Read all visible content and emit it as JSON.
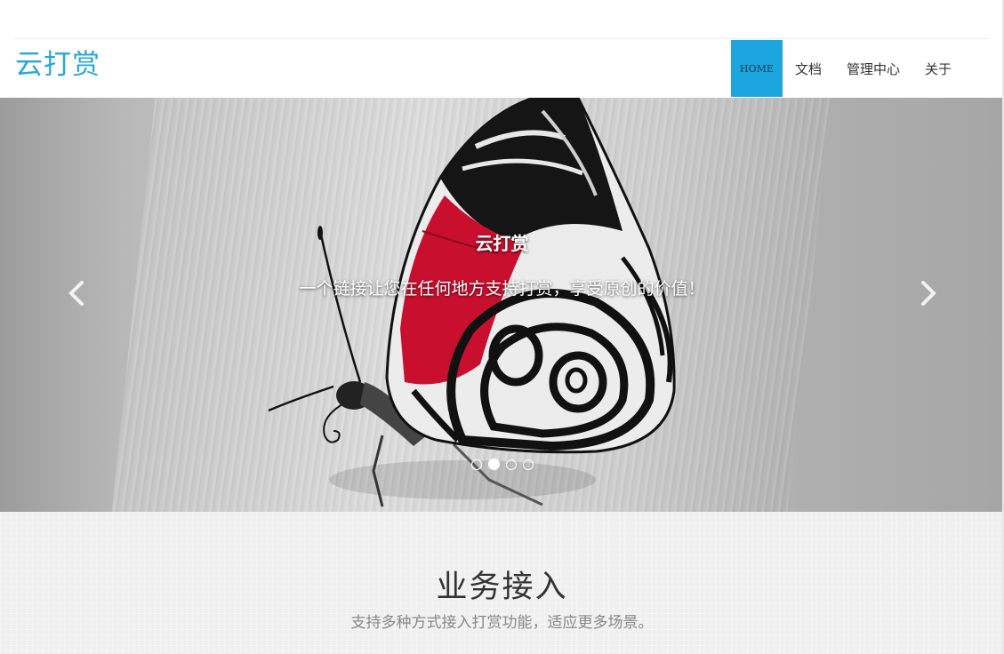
{
  "header": {
    "brand": "云打赏",
    "nav": [
      {
        "label": "HOME"
      },
      {
        "label": "文档"
      },
      {
        "label": "管理中心"
      },
      {
        "label": "关于"
      }
    ]
  },
  "carousel": {
    "title": "云打赏",
    "text": "一个链接让您在任何地方支持打赏，享受原创的价值！",
    "slide_count": 4,
    "active_index": 1,
    "prev_icon": "chevron-left-icon",
    "next_icon": "chevron-right-icon"
  },
  "section": {
    "title": "业务接入",
    "subtitle": "支持多种方式接入打赏功能，适应更多场景。"
  },
  "colors": {
    "brand": "#28a8d8",
    "nav_active_bg": "#1ba6e0",
    "section_bg": "#f0efef"
  }
}
